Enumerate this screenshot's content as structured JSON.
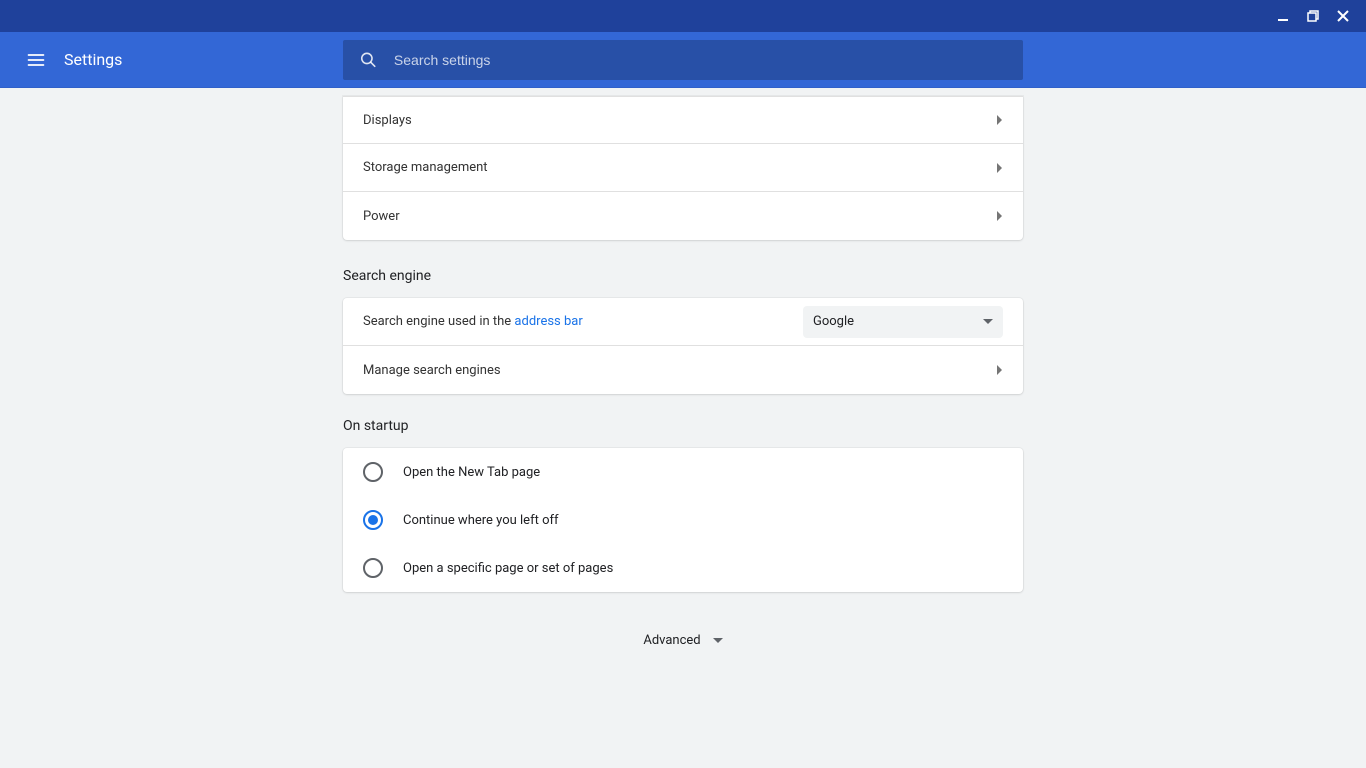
{
  "titlebar": {},
  "appbar": {
    "title": "Settings"
  },
  "search": {
    "placeholder": "Search settings"
  },
  "device_section": {
    "items": [
      {
        "label": "Displays"
      },
      {
        "label": "Storage management"
      },
      {
        "label": "Power"
      }
    ]
  },
  "search_engine_section": {
    "title": "Search engine",
    "default_row": {
      "label_prefix": "Search engine used in the ",
      "label_link": "address bar",
      "selected": "Google"
    },
    "manage_row": {
      "label": "Manage search engines"
    }
  },
  "startup_section": {
    "title": "On startup",
    "options": [
      {
        "label": "Open the New Tab page",
        "selected": false
      },
      {
        "label": "Continue where you left off",
        "selected": true
      },
      {
        "label": "Open a specific page or set of pages",
        "selected": false
      }
    ]
  },
  "advanced": {
    "label": "Advanced"
  }
}
